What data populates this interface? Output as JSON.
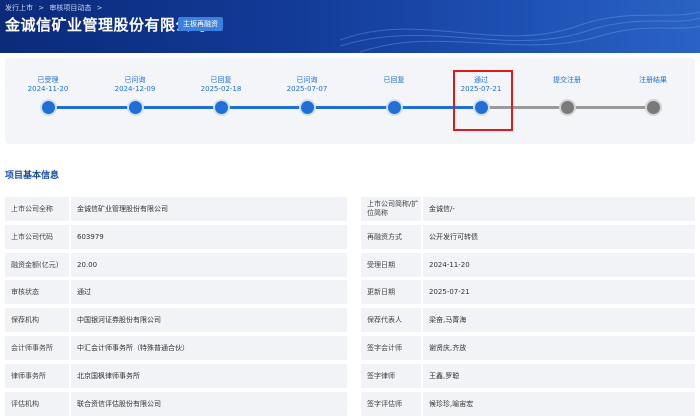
{
  "header": {
    "breadcrumb": [
      "发行上市",
      ">",
      "审核项目动态",
      ">"
    ],
    "title": "金诚信矿业管理股份有限公司",
    "board_badge": "主板再融资"
  },
  "progress": {
    "steps": [
      {
        "label": "已受理",
        "date": "2024-11-20",
        "status": "done"
      },
      {
        "label": "已问询",
        "date": "2024-12-09",
        "status": "done"
      },
      {
        "label": "已回复",
        "date": "2025-02-18",
        "status": "done"
      },
      {
        "label": "已问询",
        "date": "2025-07-07",
        "status": "done"
      },
      {
        "label": "已回复",
        "date": "",
        "status": "done"
      },
      {
        "label": "通过",
        "date": "2025-07-21",
        "status": "current"
      },
      {
        "label": "提交注册",
        "date": "",
        "status": "future"
      },
      {
        "label": "注册结果",
        "date": "",
        "status": "future"
      }
    ],
    "colors": {
      "done": "#1f6fd6",
      "future": "#7a7a7a",
      "highlight": "#e01a1a"
    }
  },
  "section": {
    "title": "项目基本信息"
  },
  "info": [
    {
      "l_label": "上市公司全称",
      "l_value": "金诚信矿业管理股份有限公司",
      "r_label": "上市公司简称/扩位简称",
      "r_value": "金诚信/-"
    },
    {
      "l_label": "上市公司代码",
      "l_value": "603979",
      "r_label": "再融资方式",
      "r_value": "公开发行可转债"
    },
    {
      "l_label": "融资金额(亿元)",
      "l_value": "20.00",
      "r_label": "受理日期",
      "r_value": "2024-11-20"
    },
    {
      "l_label": "审核状态",
      "l_value": "通过",
      "r_label": "更新日期",
      "r_value": "2025-07-21"
    },
    {
      "l_label": "保荐机构",
      "l_value": "中国银河证券股份有限公司",
      "r_label": "保荐代表人",
      "r_value": "梁奋,马菁海"
    },
    {
      "l_label": "会计师事务所",
      "l_value": "中汇会计师事务所（特殊普通合伙）",
      "r_label": "签字会计师",
      "r_value": "谢贤庆,齐放"
    },
    {
      "l_label": "律师事务所",
      "l_value": "北京国枫律师事务所",
      "r_label": "签字律师",
      "r_value": "王鑫,罗聪"
    },
    {
      "l_label": "评估机构",
      "l_value": "联合资信评估股份有限公司",
      "r_label": "签字评估师",
      "r_value": "候珍珍,喻宙宏"
    }
  ]
}
